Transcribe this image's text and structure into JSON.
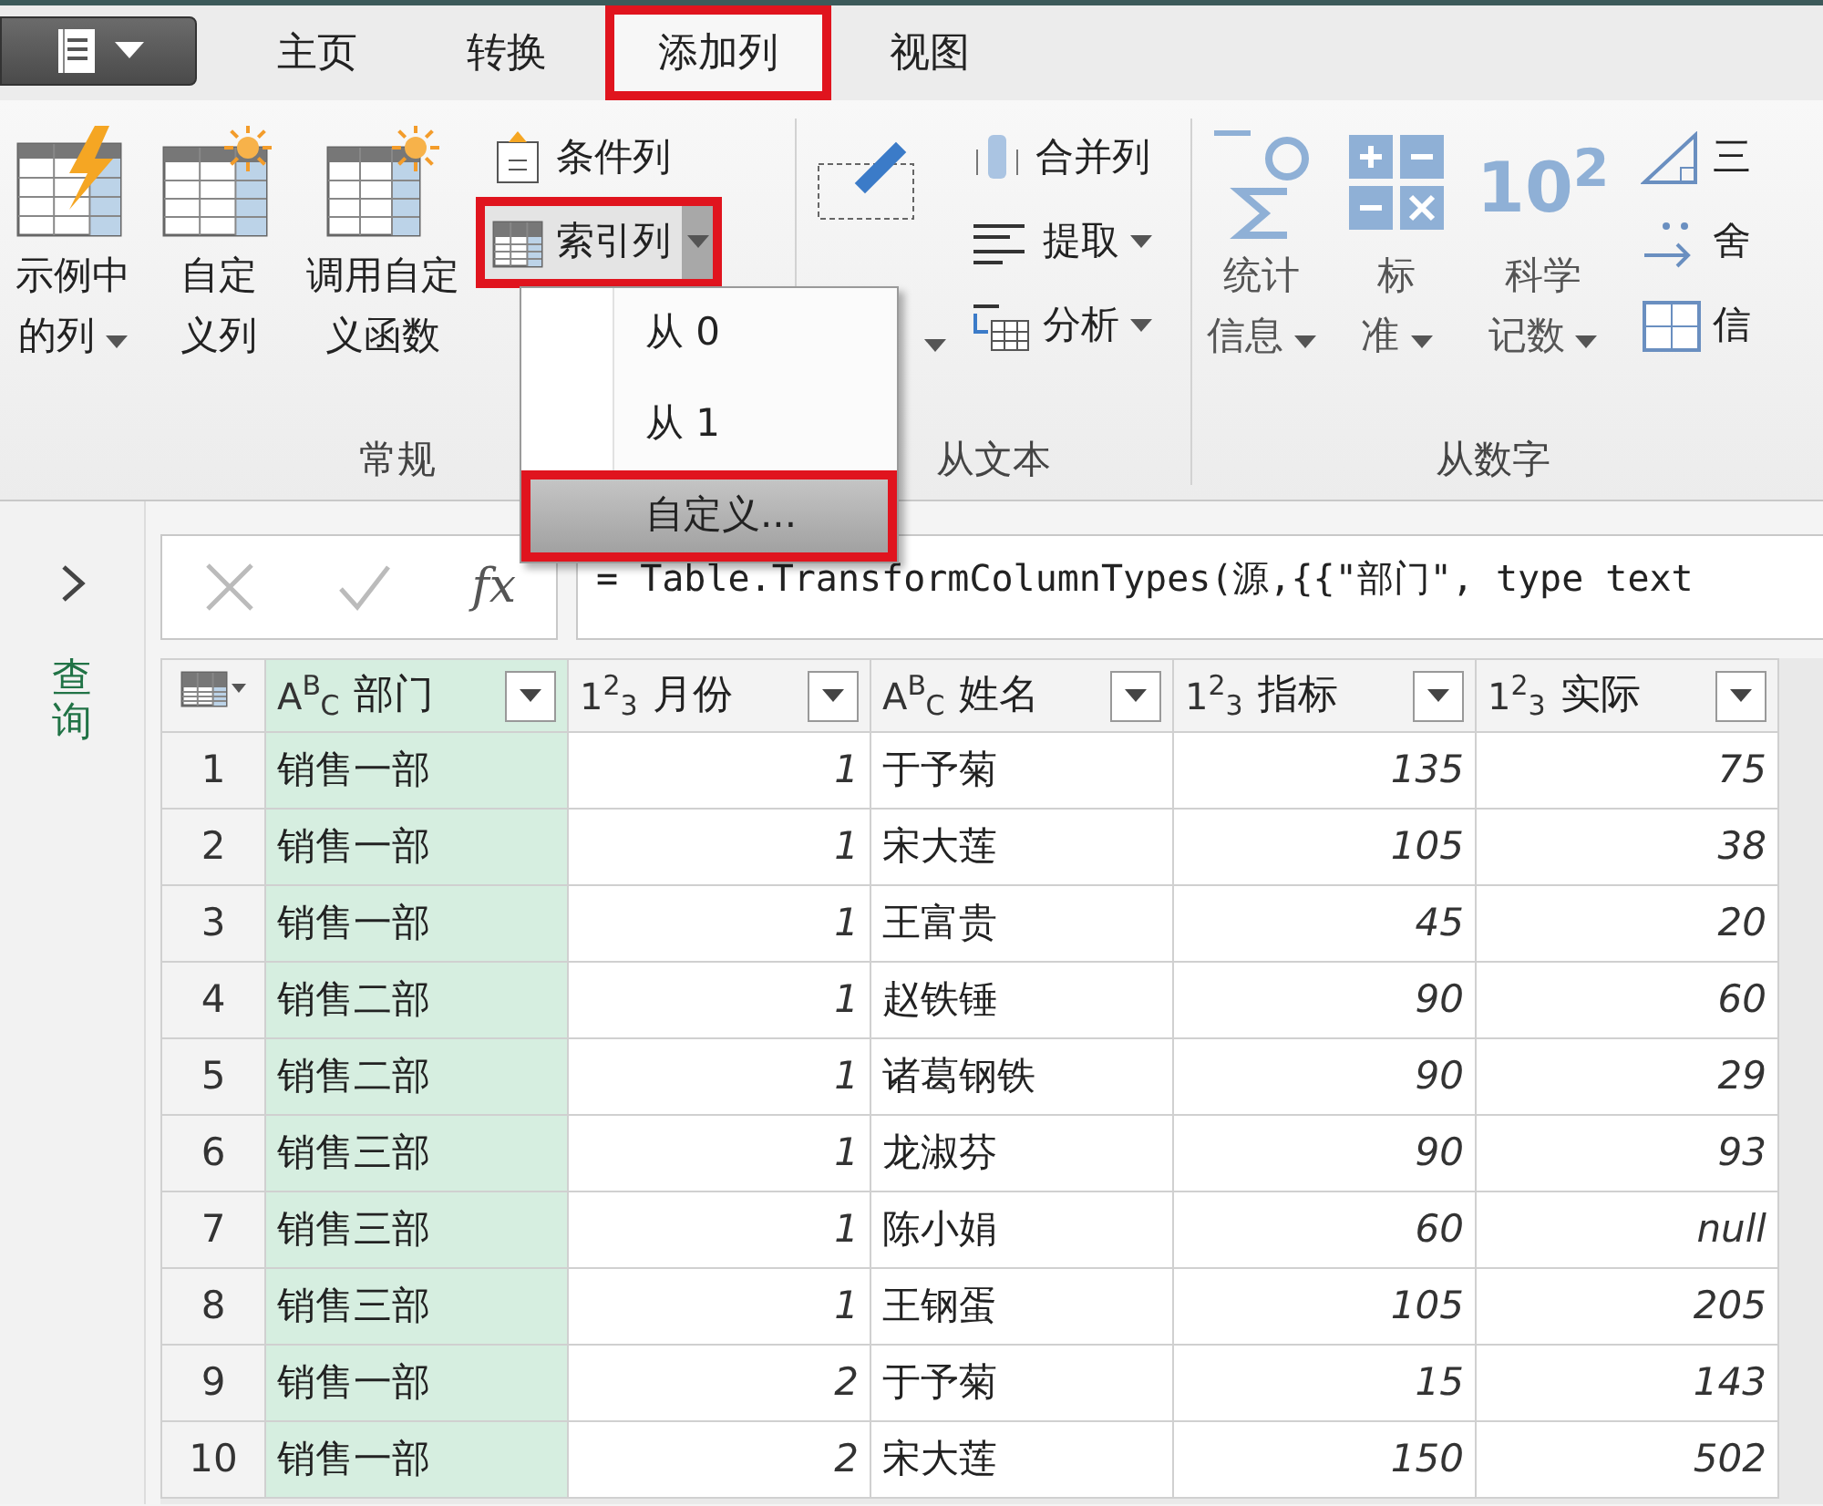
{
  "tabs": [
    {
      "label": "主页",
      "selected": false,
      "highlighted": false
    },
    {
      "label": "转换",
      "selected": false,
      "highlighted": false
    },
    {
      "label": "添加列",
      "selected": true,
      "highlighted": true
    },
    {
      "label": "视图",
      "selected": false,
      "highlighted": false
    }
  ],
  "ribbon": {
    "groups": [
      {
        "label": "常规",
        "large": [
          {
            "lines": [
              "示例中",
              "的列"
            ],
            "kind": "flash",
            "dropdown": true
          },
          {
            "lines": [
              "自定",
              "义列"
            ],
            "kind": "sun",
            "dropdown": false
          },
          {
            "lines": [
              "调用自定",
              "义函数"
            ],
            "kind": "function",
            "dropdown": false
          }
        ],
        "small": [
          {
            "label": "条件列",
            "kind": "conditional",
            "dropdown": false,
            "split": false,
            "highlighted": false
          },
          {
            "label": "索引列",
            "kind": "index",
            "dropdown": true,
            "split": true,
            "highlighted": true
          }
        ]
      },
      {
        "label": "从文本",
        "large": [
          {
            "kind": "format",
            "dropdown": true
          }
        ],
        "small": [
          {
            "label": "合并列",
            "kind": "merge",
            "dropdown": false,
            "split": false,
            "highlighted": false
          },
          {
            "label": "提取",
            "kind": "extract",
            "dropdown": true,
            "split": false,
            "highlighted": false
          },
          {
            "label": "分析",
            "kind": "parse",
            "dropdown": true,
            "split": false,
            "highlighted": false
          }
        ]
      },
      {
        "label": "从数字",
        "large": [
          {
            "lines": [
              "统计",
              "信息"
            ],
            "kind": "stats",
            "dropdown": true
          },
          {
            "lines": [
              "标",
              "准"
            ],
            "kind": "standard",
            "dropdown": true
          },
          {
            "lines": [
              "科学",
              "记数"
            ],
            "kind": "scientific",
            "glyph": "10$^{2}$",
            "dropdown": true
          }
        ],
        "small": [
          {
            "label": "三",
            "kind": "trig",
            "dropdown": false,
            "split": false,
            "highlighted": false
          },
          {
            "label": "舍",
            "kind": "round",
            "dropdown": false,
            "split": false,
            "highlighted": false
          },
          {
            "label": "信",
            "kind": "info",
            "dropdown": false,
            "split": false,
            "highlighted": false
          }
        ]
      }
    ]
  },
  "index_menu": {
    "items": [
      {
        "label": "从 0",
        "highlighted": false
      },
      {
        "label": "从 1",
        "highlighted": false
      },
      {
        "label": "自定义...",
        "highlighted": true
      }
    ]
  },
  "sidebar": {
    "title": "查询"
  },
  "formula_bar": {
    "fx": "fx",
    "formula": "= Table.TransformColumnTypes(源,{{\"部门\", type text"
  },
  "table": {
    "columns": [
      {
        "name": "部门",
        "type_label": "A$^{B}$$_{C}$",
        "kind": "text",
        "selected": true
      },
      {
        "name": "月份",
        "type_label": "1$^{2}$$_{3}$",
        "kind": "number",
        "selected": false
      },
      {
        "name": "姓名",
        "type_label": "A$^{B}$$_{C}$",
        "kind": "text",
        "selected": false
      },
      {
        "name": "指标",
        "type_label": "1$^{2}$$_{3}$",
        "kind": "number",
        "selected": false
      },
      {
        "name": "实际",
        "type_label": "1$^{2}$$_{3}$",
        "kind": "number",
        "selected": false
      }
    ],
    "rows": [
      {
        "index": "1",
        "cells": [
          "销售一部",
          "1",
          "于予菊",
          "135",
          "75"
        ]
      },
      {
        "index": "2",
        "cells": [
          "销售一部",
          "1",
          "宋大莲",
          "105",
          "38"
        ]
      },
      {
        "index": "3",
        "cells": [
          "销售一部",
          "1",
          "王富贵",
          "45",
          "20"
        ]
      },
      {
        "index": "4",
        "cells": [
          "销售二部",
          "1",
          "赵铁锤",
          "90",
          "60"
        ]
      },
      {
        "index": "5",
        "cells": [
          "销售二部",
          "1",
          "诸葛钢铁",
          "90",
          "29"
        ]
      },
      {
        "index": "6",
        "cells": [
          "销售三部",
          "1",
          "龙淑芬",
          "90",
          "93"
        ]
      },
      {
        "index": "7",
        "cells": [
          "销售三部",
          "1",
          "陈小娟",
          "60",
          "null"
        ]
      },
      {
        "index": "8",
        "cells": [
          "销售三部",
          "1",
          "王钢蛋",
          "105",
          "205"
        ]
      },
      {
        "index": "9",
        "cells": [
          "销售一部",
          "2",
          "于予菊",
          "15",
          "143"
        ]
      },
      {
        "index": "10",
        "cells": [
          "销售一部",
          "2",
          "宋大莲",
          "150",
          "502"
        ]
      }
    ]
  }
}
